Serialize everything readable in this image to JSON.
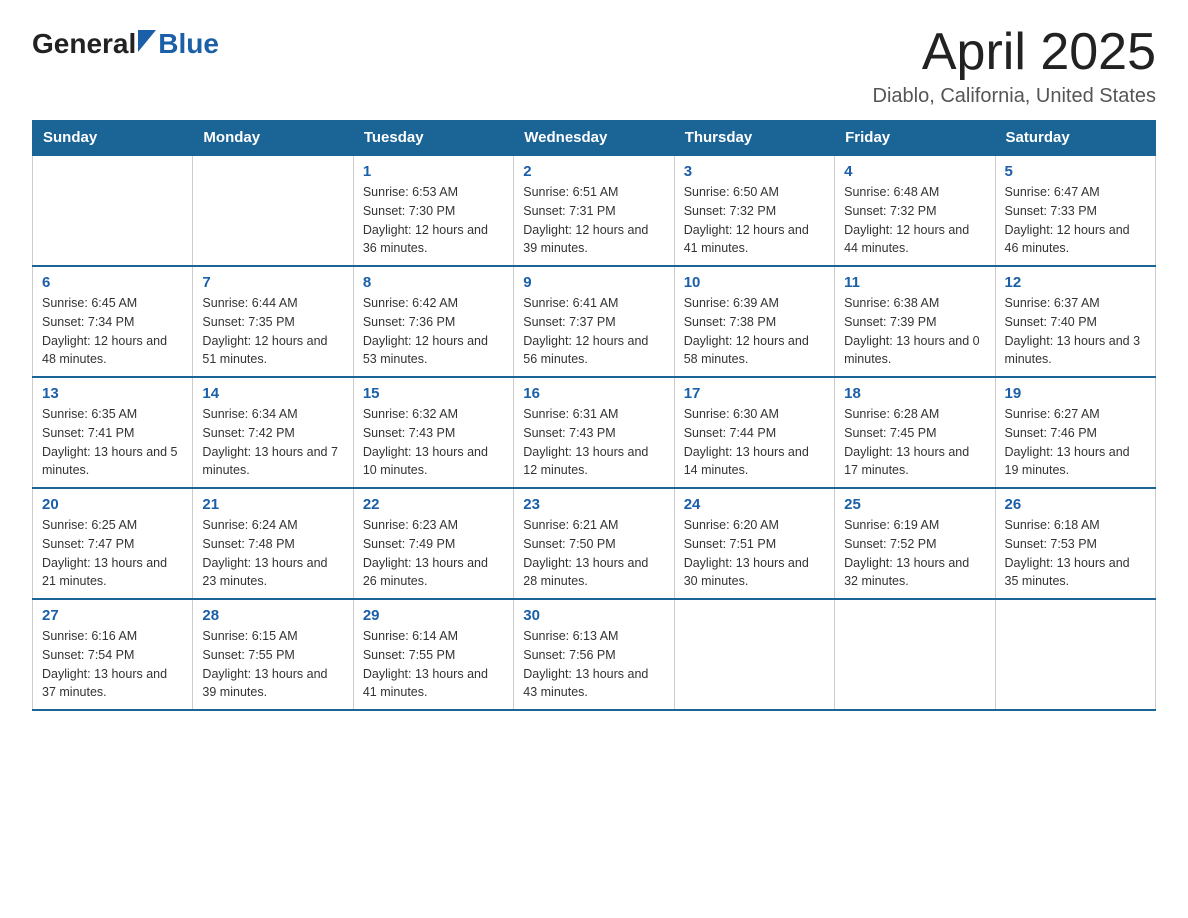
{
  "header": {
    "logo_general": "General",
    "logo_blue": "Blue",
    "title": "April 2025",
    "subtitle": "Diablo, California, United States"
  },
  "columns": [
    "Sunday",
    "Monday",
    "Tuesday",
    "Wednesday",
    "Thursday",
    "Friday",
    "Saturday"
  ],
  "weeks": [
    [
      {
        "day": "",
        "sunrise": "",
        "sunset": "",
        "daylight": ""
      },
      {
        "day": "",
        "sunrise": "",
        "sunset": "",
        "daylight": ""
      },
      {
        "day": "1",
        "sunrise": "Sunrise: 6:53 AM",
        "sunset": "Sunset: 7:30 PM",
        "daylight": "Daylight: 12 hours and 36 minutes."
      },
      {
        "day": "2",
        "sunrise": "Sunrise: 6:51 AM",
        "sunset": "Sunset: 7:31 PM",
        "daylight": "Daylight: 12 hours and 39 minutes."
      },
      {
        "day": "3",
        "sunrise": "Sunrise: 6:50 AM",
        "sunset": "Sunset: 7:32 PM",
        "daylight": "Daylight: 12 hours and 41 minutes."
      },
      {
        "day": "4",
        "sunrise": "Sunrise: 6:48 AM",
        "sunset": "Sunset: 7:32 PM",
        "daylight": "Daylight: 12 hours and 44 minutes."
      },
      {
        "day": "5",
        "sunrise": "Sunrise: 6:47 AM",
        "sunset": "Sunset: 7:33 PM",
        "daylight": "Daylight: 12 hours and 46 minutes."
      }
    ],
    [
      {
        "day": "6",
        "sunrise": "Sunrise: 6:45 AM",
        "sunset": "Sunset: 7:34 PM",
        "daylight": "Daylight: 12 hours and 48 minutes."
      },
      {
        "day": "7",
        "sunrise": "Sunrise: 6:44 AM",
        "sunset": "Sunset: 7:35 PM",
        "daylight": "Daylight: 12 hours and 51 minutes."
      },
      {
        "day": "8",
        "sunrise": "Sunrise: 6:42 AM",
        "sunset": "Sunset: 7:36 PM",
        "daylight": "Daylight: 12 hours and 53 minutes."
      },
      {
        "day": "9",
        "sunrise": "Sunrise: 6:41 AM",
        "sunset": "Sunset: 7:37 PM",
        "daylight": "Daylight: 12 hours and 56 minutes."
      },
      {
        "day": "10",
        "sunrise": "Sunrise: 6:39 AM",
        "sunset": "Sunset: 7:38 PM",
        "daylight": "Daylight: 12 hours and 58 minutes."
      },
      {
        "day": "11",
        "sunrise": "Sunrise: 6:38 AM",
        "sunset": "Sunset: 7:39 PM",
        "daylight": "Daylight: 13 hours and 0 minutes."
      },
      {
        "day": "12",
        "sunrise": "Sunrise: 6:37 AM",
        "sunset": "Sunset: 7:40 PM",
        "daylight": "Daylight: 13 hours and 3 minutes."
      }
    ],
    [
      {
        "day": "13",
        "sunrise": "Sunrise: 6:35 AM",
        "sunset": "Sunset: 7:41 PM",
        "daylight": "Daylight: 13 hours and 5 minutes."
      },
      {
        "day": "14",
        "sunrise": "Sunrise: 6:34 AM",
        "sunset": "Sunset: 7:42 PM",
        "daylight": "Daylight: 13 hours and 7 minutes."
      },
      {
        "day": "15",
        "sunrise": "Sunrise: 6:32 AM",
        "sunset": "Sunset: 7:43 PM",
        "daylight": "Daylight: 13 hours and 10 minutes."
      },
      {
        "day": "16",
        "sunrise": "Sunrise: 6:31 AM",
        "sunset": "Sunset: 7:43 PM",
        "daylight": "Daylight: 13 hours and 12 minutes."
      },
      {
        "day": "17",
        "sunrise": "Sunrise: 6:30 AM",
        "sunset": "Sunset: 7:44 PM",
        "daylight": "Daylight: 13 hours and 14 minutes."
      },
      {
        "day": "18",
        "sunrise": "Sunrise: 6:28 AM",
        "sunset": "Sunset: 7:45 PM",
        "daylight": "Daylight: 13 hours and 17 minutes."
      },
      {
        "day": "19",
        "sunrise": "Sunrise: 6:27 AM",
        "sunset": "Sunset: 7:46 PM",
        "daylight": "Daylight: 13 hours and 19 minutes."
      }
    ],
    [
      {
        "day": "20",
        "sunrise": "Sunrise: 6:25 AM",
        "sunset": "Sunset: 7:47 PM",
        "daylight": "Daylight: 13 hours and 21 minutes."
      },
      {
        "day": "21",
        "sunrise": "Sunrise: 6:24 AM",
        "sunset": "Sunset: 7:48 PM",
        "daylight": "Daylight: 13 hours and 23 minutes."
      },
      {
        "day": "22",
        "sunrise": "Sunrise: 6:23 AM",
        "sunset": "Sunset: 7:49 PM",
        "daylight": "Daylight: 13 hours and 26 minutes."
      },
      {
        "day": "23",
        "sunrise": "Sunrise: 6:21 AM",
        "sunset": "Sunset: 7:50 PM",
        "daylight": "Daylight: 13 hours and 28 minutes."
      },
      {
        "day": "24",
        "sunrise": "Sunrise: 6:20 AM",
        "sunset": "Sunset: 7:51 PM",
        "daylight": "Daylight: 13 hours and 30 minutes."
      },
      {
        "day": "25",
        "sunrise": "Sunrise: 6:19 AM",
        "sunset": "Sunset: 7:52 PM",
        "daylight": "Daylight: 13 hours and 32 minutes."
      },
      {
        "day": "26",
        "sunrise": "Sunrise: 6:18 AM",
        "sunset": "Sunset: 7:53 PM",
        "daylight": "Daylight: 13 hours and 35 minutes."
      }
    ],
    [
      {
        "day": "27",
        "sunrise": "Sunrise: 6:16 AM",
        "sunset": "Sunset: 7:54 PM",
        "daylight": "Daylight: 13 hours and 37 minutes."
      },
      {
        "day": "28",
        "sunrise": "Sunrise: 6:15 AM",
        "sunset": "Sunset: 7:55 PM",
        "daylight": "Daylight: 13 hours and 39 minutes."
      },
      {
        "day": "29",
        "sunrise": "Sunrise: 6:14 AM",
        "sunset": "Sunset: 7:55 PM",
        "daylight": "Daylight: 13 hours and 41 minutes."
      },
      {
        "day": "30",
        "sunrise": "Sunrise: 6:13 AM",
        "sunset": "Sunset: 7:56 PM",
        "daylight": "Daylight: 13 hours and 43 minutes."
      },
      {
        "day": "",
        "sunrise": "",
        "sunset": "",
        "daylight": ""
      },
      {
        "day": "",
        "sunrise": "",
        "sunset": "",
        "daylight": ""
      },
      {
        "day": "",
        "sunrise": "",
        "sunset": "",
        "daylight": ""
      }
    ]
  ]
}
